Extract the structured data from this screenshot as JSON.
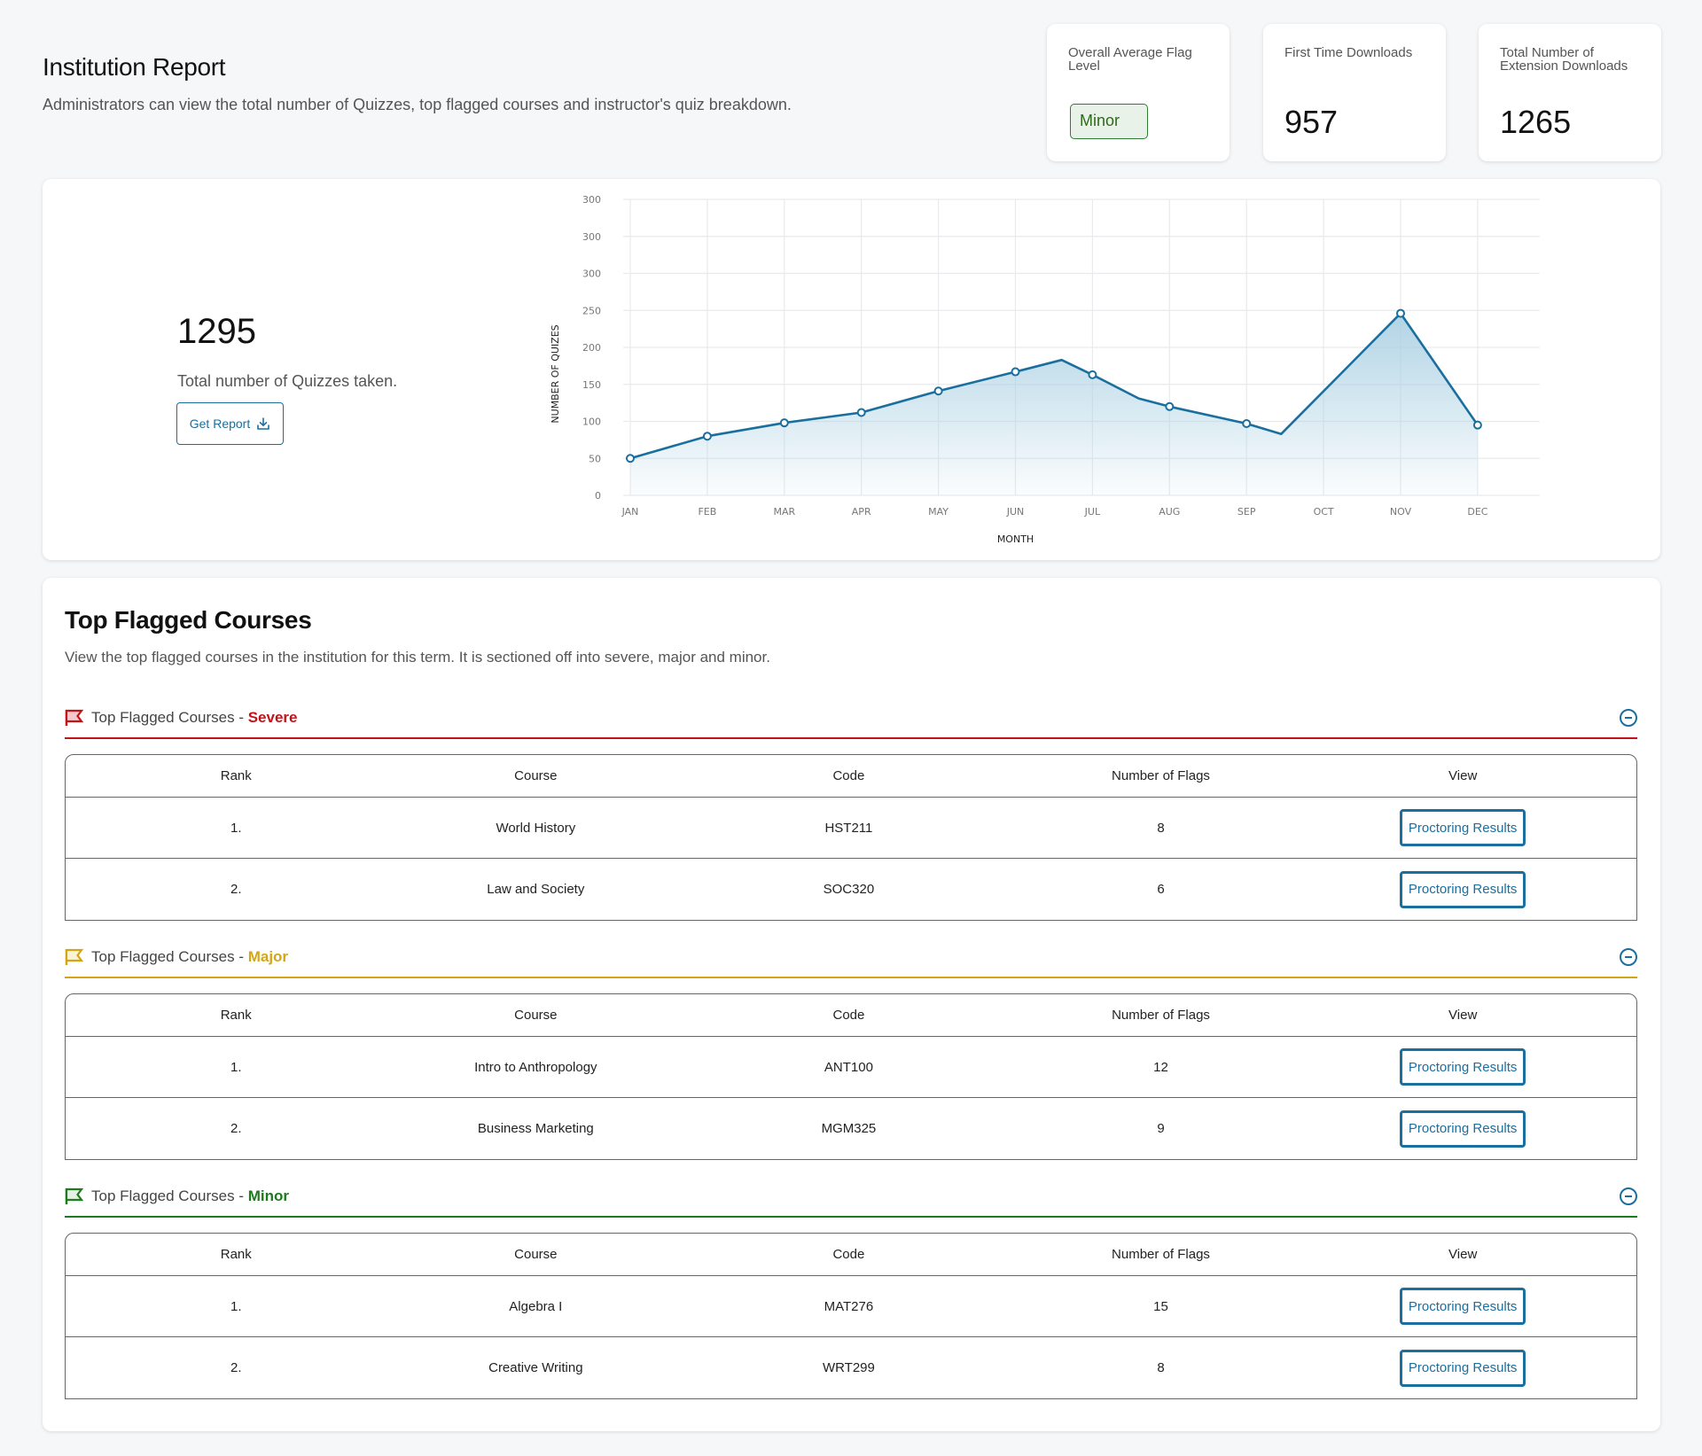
{
  "header": {
    "title": "Institution Report",
    "subtitle": "Administrators can view the total number of Quizzes, top flagged courses and instructor's quiz breakdown."
  },
  "stats": [
    {
      "label": "Overall Average Flag Level",
      "badge": "Minor"
    },
    {
      "label": "First Time Downloads",
      "value": "957"
    },
    {
      "label": "Total Number of Extension Downloads",
      "value": "1265"
    }
  ],
  "quizzes": {
    "total": "1295",
    "label": "Total number of Quizzes taken.",
    "report_button": "Get Report",
    "report_icon": "download-icon"
  },
  "chart_data": {
    "type": "area",
    "title": "",
    "xlabel": "MONTH",
    "ylabel": "NUMBER OF QUIZES",
    "categories": [
      "JAN",
      "FEB",
      "MAR",
      "APR",
      "MAY",
      "JUN",
      "JUL",
      "AUG",
      "SEP",
      "OCT",
      "NOV",
      "DEC"
    ],
    "y_tick_labels": [
      "0",
      "50",
      "100",
      "150",
      "200",
      "250",
      "300",
      "300",
      "300"
    ],
    "ylim": [
      0,
      400
    ],
    "grid": true,
    "points": [
      {
        "x": 0,
        "y": 50,
        "marker": true
      },
      {
        "x": 1,
        "y": 80,
        "marker": true
      },
      {
        "x": 2,
        "y": 98,
        "marker": true
      },
      {
        "x": 3,
        "y": 112,
        "marker": true
      },
      {
        "x": 4,
        "y": 141,
        "marker": true
      },
      {
        "x": 5,
        "y": 167,
        "marker": true
      },
      {
        "x": 5.6,
        "y": 183,
        "marker": false
      },
      {
        "x": 6,
        "y": 163,
        "marker": true
      },
      {
        "x": 6.6,
        "y": 131,
        "marker": false
      },
      {
        "x": 7,
        "y": 120,
        "marker": true
      },
      {
        "x": 8,
        "y": 97,
        "marker": true
      },
      {
        "x": 8.45,
        "y": 83,
        "marker": false
      },
      {
        "x": 10,
        "y": 246,
        "marker": true
      },
      {
        "x": 11,
        "y": 95,
        "marker": true
      }
    ],
    "line_color": "#1a6f9e",
    "fill_color": "#a9cfe2"
  },
  "flagged": {
    "title": "Top Flagged Courses",
    "description": "View the top flagged courses in the institution for this term. It is sectioned off into severe, major and minor.",
    "columns": [
      "Rank",
      "Course",
      "Code",
      "Number of Flags",
      "View"
    ],
    "sections": [
      {
        "prefix": "Top Flagged Courses - ",
        "level": "Severe",
        "color": "#c0141a",
        "icon_fill": "#f5c9cb",
        "rows": [
          {
            "rank": "1.",
            "course": "World History",
            "code": "HST211",
            "flags": "8",
            "view": "Proctoring Results"
          },
          {
            "rank": "2.",
            "course": "Law and Society",
            "code": "SOC320",
            "flags": "6",
            "view": "Proctoring Results"
          }
        ]
      },
      {
        "prefix": "Top Flagged Courses - ",
        "level": "Major",
        "color": "#d4a514",
        "icon_fill": "#faf3d6",
        "rows": [
          {
            "rank": "1.",
            "course": "Intro to Anthropology",
            "code": "ANT100",
            "flags": "12",
            "view": "Proctoring Results"
          },
          {
            "rank": "2.",
            "course": "Business Marketing",
            "code": "MGM325",
            "flags": "9",
            "view": "Proctoring Results"
          }
        ]
      },
      {
        "prefix": "Top Flagged Courses - ",
        "level": "Minor",
        "color": "#1f7a1f",
        "icon_fill": "#e3f0e3",
        "rows": [
          {
            "rank": "1.",
            "course": "Algebra I",
            "code": "MAT276",
            "flags": "15",
            "view": "Proctoring Results"
          },
          {
            "rank": "2.",
            "course": "Creative Writing",
            "code": "WRT299",
            "flags": "8",
            "view": "Proctoring Results"
          }
        ]
      }
    ]
  }
}
